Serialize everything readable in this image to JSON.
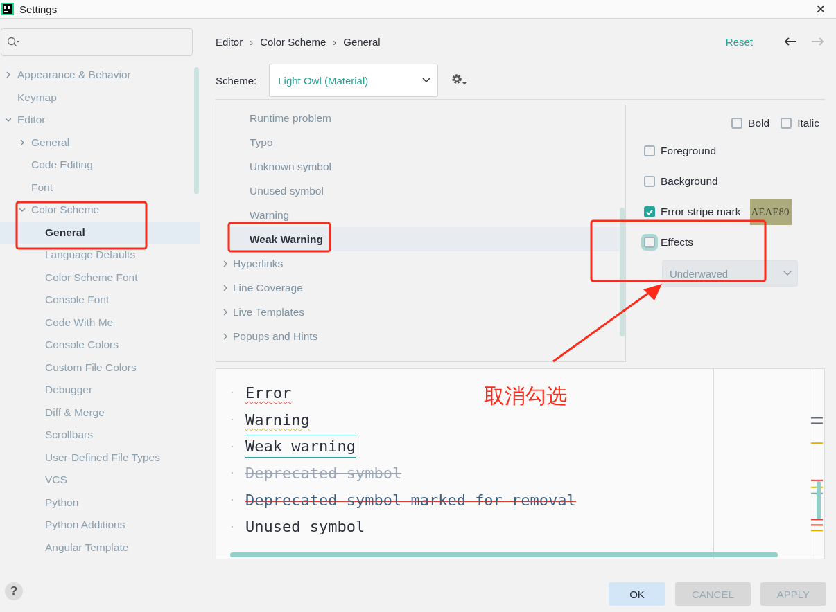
{
  "window": {
    "title": "Settings",
    "close": "×"
  },
  "sidebar": {
    "items": [
      {
        "label": "Appearance & Behavior",
        "expanded": false,
        "selected": false
      },
      {
        "label": "Keymap",
        "selected": false
      },
      {
        "label": "Editor",
        "expanded": true,
        "selected": false,
        "children": [
          {
            "label": "General",
            "expanded": false,
            "selected": false
          },
          {
            "label": "Code Editing",
            "selected": false
          },
          {
            "label": "Font",
            "selected": false
          },
          {
            "label": "Color Scheme",
            "expanded": true,
            "selected": false,
            "children": [
              {
                "label": "General",
                "selected": true
              },
              {
                "label": "Language Defaults",
                "selected": false
              },
              {
                "label": "Color Scheme Font",
                "selected": false
              },
              {
                "label": "Console Font",
                "selected": false
              },
              {
                "label": "Code With Me",
                "selected": false
              },
              {
                "label": "Console Colors",
                "selected": false
              },
              {
                "label": "Custom File Colors",
                "selected": false
              },
              {
                "label": "Debugger",
                "selected": false
              },
              {
                "label": "Diff & Merge",
                "selected": false
              },
              {
                "label": "Scrollbars",
                "selected": false
              },
              {
                "label": "User-Defined File Types",
                "selected": false
              },
              {
                "label": "VCS",
                "selected": false
              },
              {
                "label": "Python",
                "selected": false
              },
              {
                "label": "Python Additions",
                "selected": false
              },
              {
                "label": "Angular Template",
                "selected": false
              }
            ]
          }
        ]
      }
    ]
  },
  "help": "?",
  "breadcrumb": [
    "Editor",
    "Color Scheme",
    "General"
  ],
  "breadcrumb_separator": "›",
  "reset": "Reset",
  "nav": {
    "back_enabled": true,
    "forward_enabled": false
  },
  "scheme": {
    "label": "Scheme:",
    "value": "Light Owl (Material)"
  },
  "attributes_tree": {
    "visible_children": [
      {
        "label": "Runtime problem",
        "selected": false
      },
      {
        "label": "Typo",
        "selected": false
      },
      {
        "label": "Unknown symbol",
        "selected": false
      },
      {
        "label": "Unused symbol",
        "selected": false
      },
      {
        "label": "Warning",
        "selected": false
      },
      {
        "label": "Weak Warning",
        "selected": true
      }
    ],
    "categories": [
      {
        "label": "Hyperlinks",
        "expanded": false,
        "selected": false
      },
      {
        "label": "Line Coverage",
        "expanded": false,
        "selected": false
      },
      {
        "label": "Live Templates",
        "expanded": false,
        "selected": false
      },
      {
        "label": "Popups and Hints",
        "expanded": false,
        "selected": false
      }
    ]
  },
  "options": {
    "bold": {
      "label": "Bold",
      "checked": false
    },
    "italic": {
      "label": "Italic",
      "checked": false
    },
    "rows": [
      {
        "label": "Foreground",
        "checked": false
      },
      {
        "label": "Background",
        "checked": false
      },
      {
        "label": "Error stripe mark",
        "checked": true,
        "swatch": "AEAE80",
        "color": "#abab7e"
      },
      {
        "label": "Effects",
        "checked": false,
        "focused": true
      }
    ],
    "effect_type": {
      "value": "Underwaved",
      "disabled": true
    }
  },
  "preview": {
    "lines": [
      {
        "text": "Error",
        "kind": "error"
      },
      {
        "text": "Warning",
        "kind": "warning"
      },
      {
        "text": "Weak warning",
        "kind": "weak_warning"
      },
      {
        "text": "Deprecated symbol",
        "kind": "deprecated"
      },
      {
        "text": "Deprecated symbol marked for removal",
        "kind": "removal"
      },
      {
        "text": "Unused symbol",
        "kind": "plain"
      }
    ]
  },
  "annotation": {
    "text": "取消勾选"
  },
  "buttons": [
    {
      "label": "OK",
      "default": true
    },
    {
      "label": "CANCEL",
      "default": false
    },
    {
      "label": "APPLY",
      "default": false
    }
  ]
}
